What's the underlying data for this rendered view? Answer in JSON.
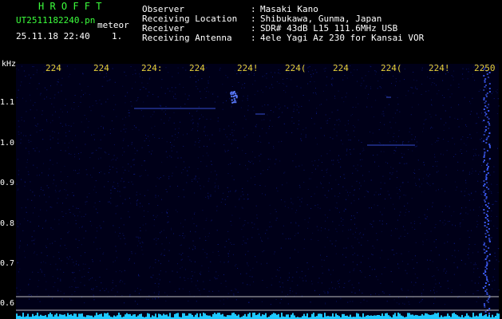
{
  "header": {
    "brand": "H R O F F T",
    "filename": "UT2511182240.pn",
    "tag": "meteor",
    "datetime": "25.11.18 22:40",
    "index": "1.",
    "fields": [
      {
        "label": "Observer",
        "value": "Masaki Kano"
      },
      {
        "label": "Receiving Location",
        "value": "Shibukawa, Gunma, Japan"
      },
      {
        "label": "Receiver",
        "value": "SDR# 43dB L15 111.6MHz USB"
      },
      {
        "label": "Receiving Antenna",
        "value": "4ele Yagi Az 230 for Kansai VOR"
      }
    ]
  },
  "spectrogram": {
    "unit": "kHz",
    "time_ticks": [
      "224",
      "224",
      "224:",
      "224",
      "224!",
      "224(",
      "224",
      "224(",
      "224!",
      "2250"
    ],
    "freq_ticks": [
      "1.1",
      "1.0",
      "0.9",
      "0.8",
      "0.7",
      "0.6"
    ],
    "colors": {
      "background": "#000018",
      "noise": "#1020a0",
      "signal": "#4060ff",
      "tick_text": "#e8d13a"
    }
  }
}
